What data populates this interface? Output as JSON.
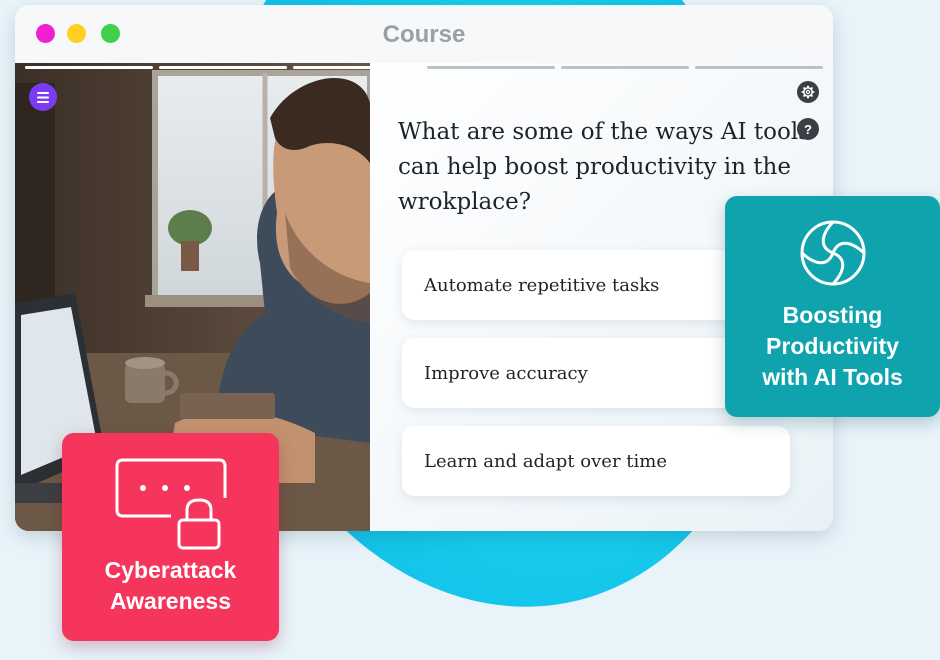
{
  "window": {
    "title": "Course",
    "dot_colors": [
      "#f01fd0",
      "#ffd020",
      "#3ed04a"
    ]
  },
  "progress": {
    "segments": 6,
    "completed": 3,
    "active_color": "#ffffff",
    "inactive_color": "#b9c2c9"
  },
  "toolbar": {
    "menu_icon": "menu-icon",
    "settings_icon": "gear-icon",
    "help_icon": "help-icon",
    "help_glyph": "?"
  },
  "quiz": {
    "question": "What are some of the ways AI tools can help boost productivity in the wrokplace?",
    "answers": [
      {
        "label": "Automate repetitive tasks"
      },
      {
        "label": "Improve accuracy"
      },
      {
        "label": "Learn and adapt over time"
      }
    ]
  },
  "cards": {
    "productivity": {
      "title_line1": "Boosting",
      "title_line2": "Productivity",
      "title_line3": "with AI Tools",
      "icon": "aperture-icon",
      "color": "#0fa3ad"
    },
    "cyberattack": {
      "title_line1": "Cyberattack",
      "title_line2": "Awareness",
      "icon": "password-lock-icon",
      "color": "#f5355c"
    }
  },
  "colors": {
    "accent_purple": "#7a3cf0",
    "background": "#e9f3fa",
    "blob": "#15c8ea"
  }
}
